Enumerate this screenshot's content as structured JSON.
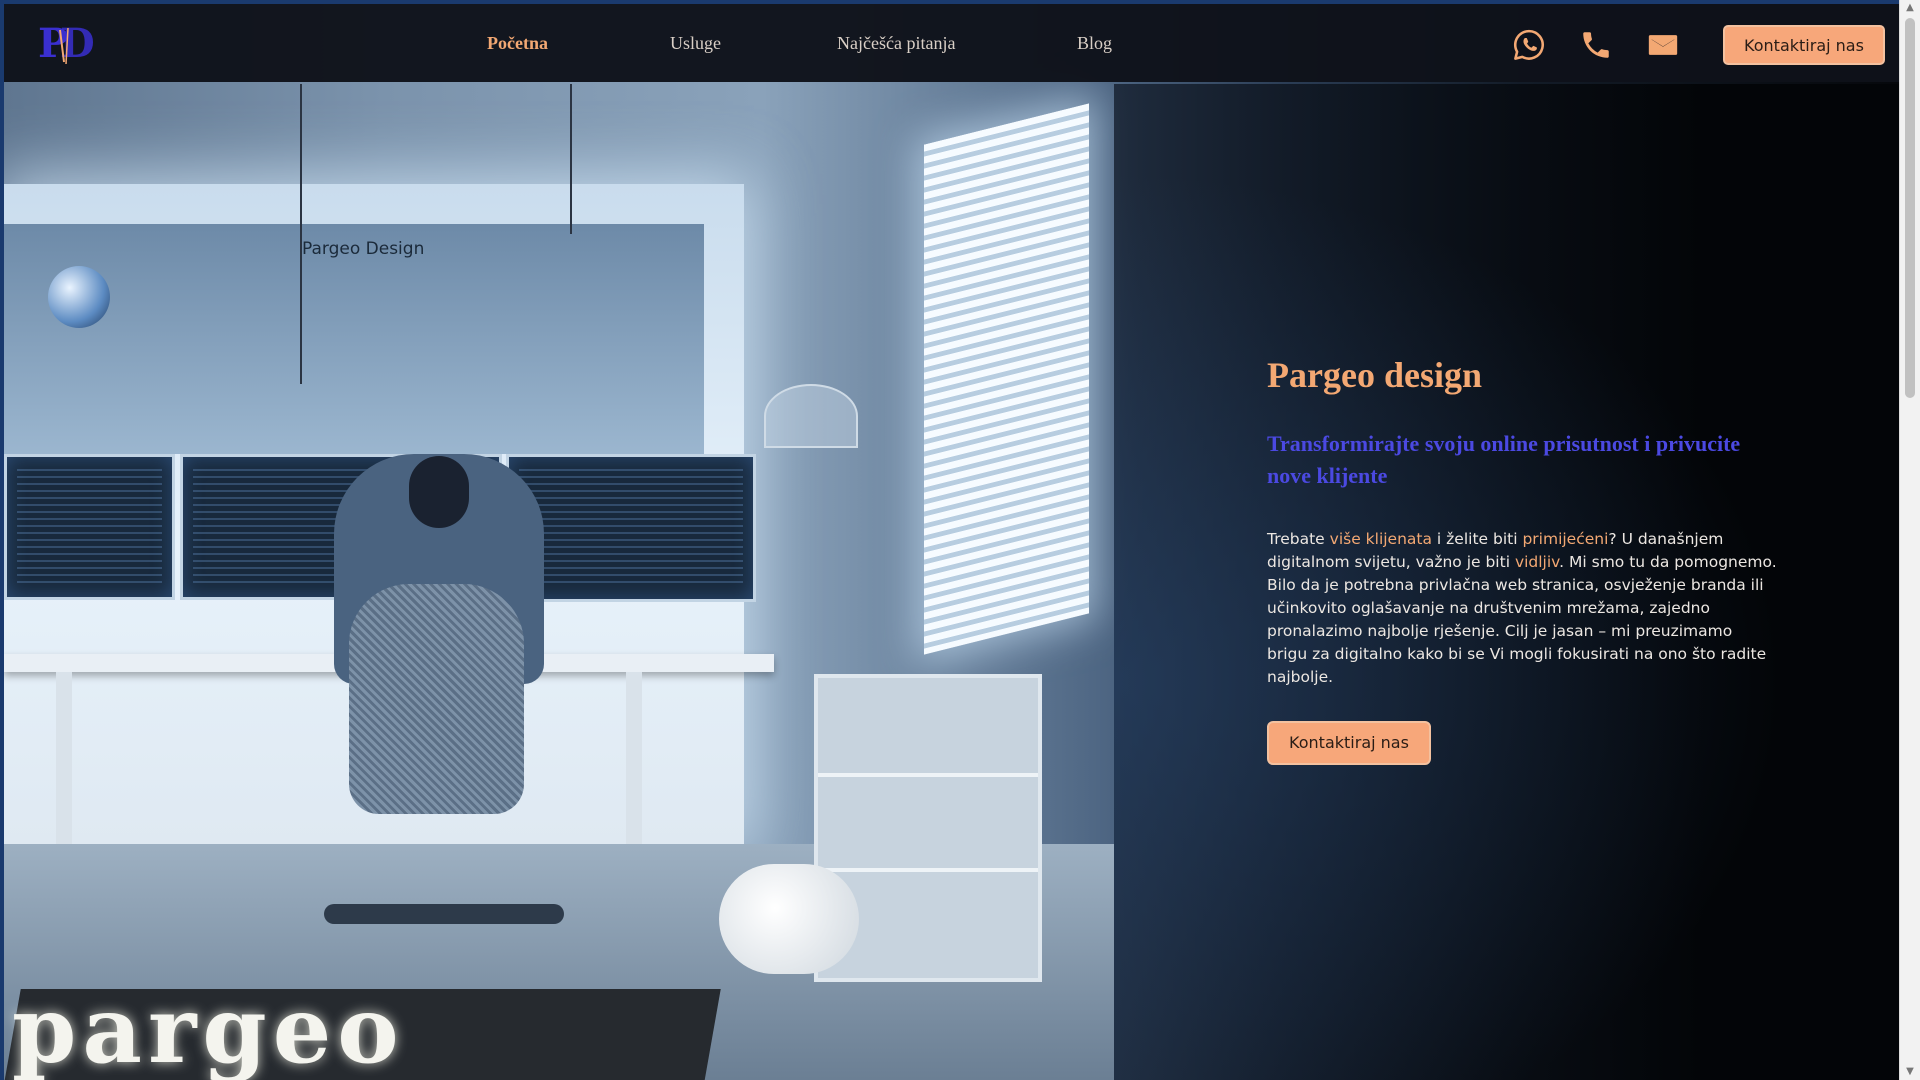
{
  "brand": {
    "logo_letters": "PD",
    "colors": {
      "accent": "#f3a873",
      "button": "#f7a77a",
      "subtitle": "#4b49e2",
      "nav_bg": "#0e121a",
      "logo_purple": "#3a2fd0"
    }
  },
  "nav": {
    "links": [
      {
        "label": "Početna",
        "active": true
      },
      {
        "label": "Usluge",
        "active": false
      },
      {
        "label": "Najčešća pitanja",
        "active": false
      },
      {
        "label": "Blog",
        "active": false
      }
    ],
    "icons": [
      "whatsapp-icon",
      "phone-icon",
      "email-icon"
    ],
    "cta_label": "Kontaktiraj nas"
  },
  "hero": {
    "image_text_board": "Pargeo Design",
    "image_text_rug": "pargeo",
    "title": "Pargeo design",
    "subtitle": "Transformirajte svoju online prisutnost i privucite nove klijente",
    "paragraph": {
      "p1": "Trebate ",
      "h1": "više klijenata",
      "p2": " i želite biti ",
      "h2": "primijećeni",
      "p3": "? U današnjem digitalnom svijetu, važno je biti ",
      "h3": "vidljiv",
      "p4": ". Mi smo tu da pomognemo. Bilo da je potrebna privlačna web stranica, osvježenje branda ili učinkovito oglašavanje na društvenim mrežama, zajedno pronalazimo najbolje rješenje. Cilj je jasan – mi preuzimamo brigu za digitalno kako bi se Vi mogli fokusirati na ono što radite najbolje."
    },
    "cta_label": "Kontaktiraj nas"
  }
}
